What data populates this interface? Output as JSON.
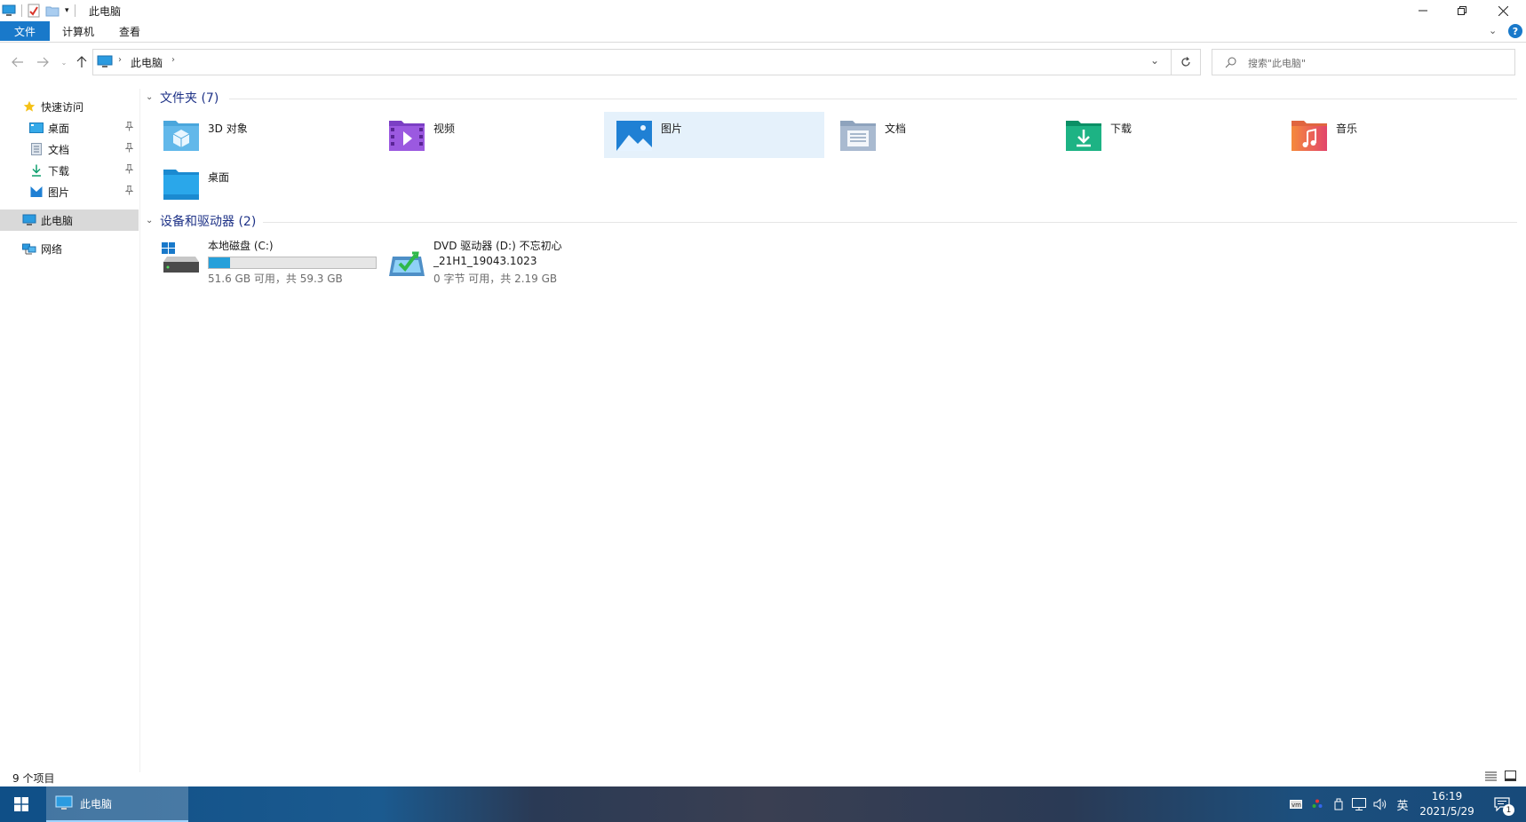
{
  "window": {
    "title": "此电脑"
  },
  "ribbon": {
    "tabs": [
      "文件",
      "计算机",
      "查看"
    ]
  },
  "address": {
    "segments": [
      "此电脑"
    ],
    "search_placeholder": "搜索\"此电脑\""
  },
  "navpane": {
    "quick_access": "快速访问",
    "pinned": [
      "桌面",
      "文档",
      "下载",
      "图片"
    ],
    "this_pc": "此电脑",
    "network": "网络"
  },
  "folders": {
    "header": "文件夹 (7)",
    "items": [
      "3D 对象",
      "视频",
      "图片",
      "文档",
      "下载",
      "音乐",
      "桌面"
    ]
  },
  "devices": {
    "header": "设备和驱动器 (2)",
    "drives": [
      {
        "name": "本地磁盘 (C:)",
        "free_text": "51.6 GB 可用，共 59.3 GB",
        "used_fraction": 0.13
      },
      {
        "name_line1": "DVD 驱动器 (D:) 不忘初心",
        "name_line2": "_21H1_19043.1023",
        "free_text": "0 字节 可用，共 2.19 GB"
      }
    ]
  },
  "status": {
    "item_count": "9 个项目"
  },
  "taskbar": {
    "app_label": "此电脑",
    "ime": "英",
    "time": "16:19",
    "date": "2021/5/29",
    "notification_count": "1"
  },
  "colors": {
    "accent": "#1979ca",
    "selection": "#e5f1fb",
    "header_text": "#1e3287"
  }
}
